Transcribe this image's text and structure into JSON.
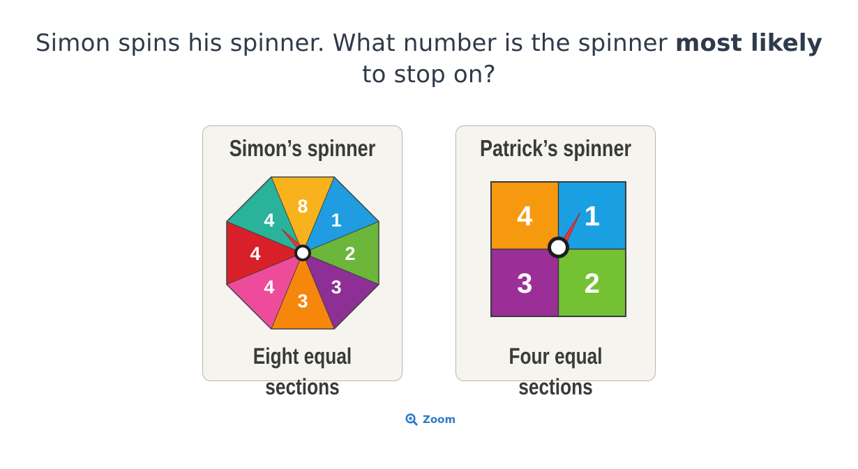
{
  "question": {
    "text_before": "Simon spins his spinner. What number is the spinner ",
    "emphasis": "most likely",
    "text_after": " to stop on?"
  },
  "cards": [
    {
      "title": "Simon’s spinner",
      "caption": "Eight equal sections",
      "sections": [
        {
          "label": "8",
          "color": "#f7b21c"
        },
        {
          "label": "1",
          "color": "#1f9de0"
        },
        {
          "label": "2",
          "color": "#6cb63b"
        },
        {
          "label": "3",
          "color": "#8e2f95"
        },
        {
          "label": "3",
          "color": "#f7860d"
        },
        {
          "label": "4",
          "color": "#ef4b9b"
        },
        {
          "label": "4",
          "color": "#d8202a"
        },
        {
          "label": "4",
          "color": "#2ab39a"
        }
      ]
    },
    {
      "title": "Patrick’s spinner",
      "caption": "Four equal sections",
      "sections": [
        {
          "label": "4",
          "color": "#f7990e"
        },
        {
          "label": "1",
          "color": "#1b9fe3"
        },
        {
          "label": "3",
          "color": "#9b2f97"
        },
        {
          "label": "2",
          "color": "#74c234"
        }
      ]
    }
  ],
  "zoom": {
    "label": "Zoom",
    "icon": "zoom-in-icon",
    "color": "#2f7bc9"
  }
}
